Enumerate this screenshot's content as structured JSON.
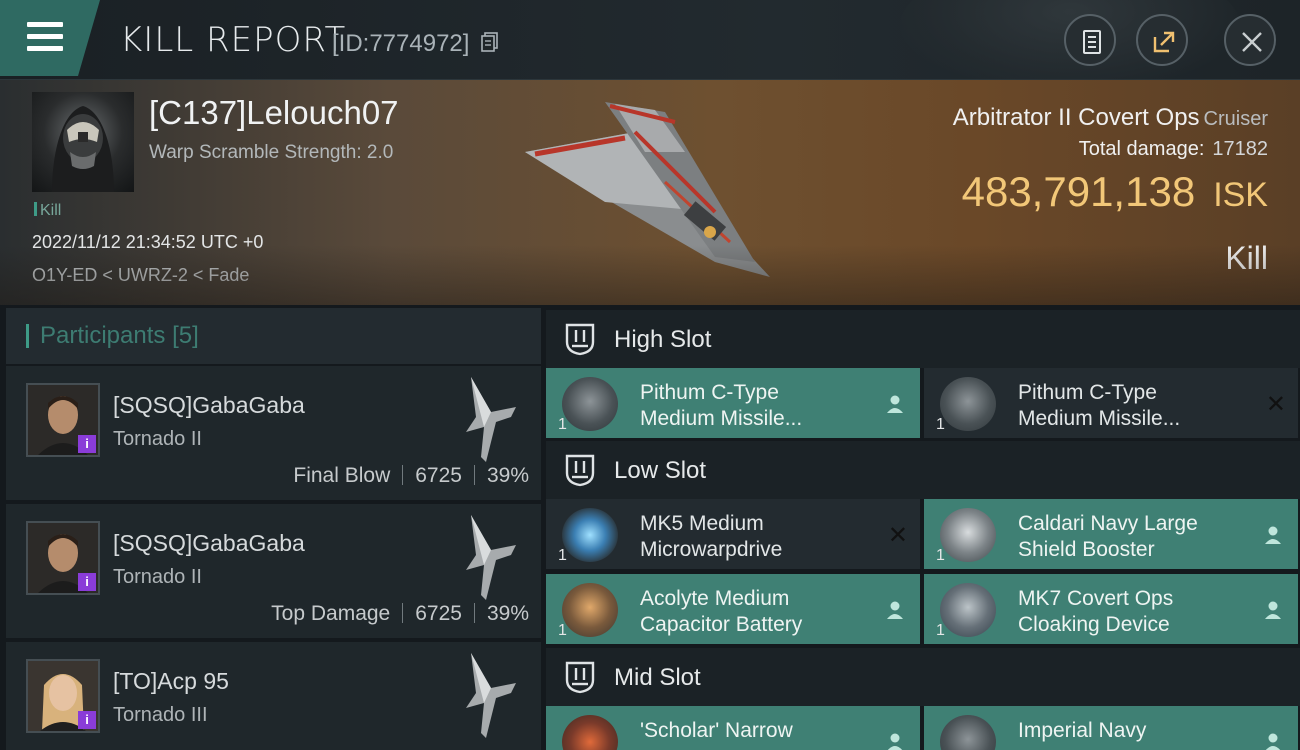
{
  "header": {
    "title": "KILL REPORT",
    "report_id": "[ID:7774972]"
  },
  "victim": {
    "name": "[C137]Lelouch07",
    "scramble": "Warp Scramble Strength: 2.0",
    "kill_tag": "Kill",
    "datetime": "2022/11/12 21:34:52 UTC +0",
    "location": "O1Y-ED < UWRZ-2 < Fade"
  },
  "ship": {
    "name": "Arbitrator II Covert Ops",
    "class": "Cruiser",
    "damage_label": "Total damage:",
    "damage_value": "17182",
    "isk_value": "483,791,138",
    "isk_unit": "ISK",
    "result": "Kill"
  },
  "participants": {
    "label": "Participants",
    "count": "[5]",
    "items": [
      {
        "name": "[SQSQ]GabaGaba",
        "ship": "Tornado II",
        "role": "Final Blow",
        "damage": "6725",
        "percent": "39%"
      },
      {
        "name": "[SQSQ]GabaGaba",
        "ship": "Tornado II",
        "role": "Top Damage",
        "damage": "6725",
        "percent": "39%"
      },
      {
        "name": "[TO]Acp 95",
        "ship": "Tornado III",
        "role": "",
        "damage": "",
        "percent": ""
      }
    ]
  },
  "slots": {
    "high": {
      "title": "High Slot",
      "modules": [
        {
          "name": "Pithum C-Type\nMedium Missile...",
          "qty": "1"
        },
        {
          "name": "Pithum C-Type\nMedium Missile...",
          "qty": "1"
        }
      ]
    },
    "low": {
      "title": "Low Slot",
      "modules": [
        {
          "name": "MK5 Medium\nMicrowarpdrive",
          "qty": "1"
        },
        {
          "name": "Caldari Navy Large\nShield Booster",
          "qty": "1"
        },
        {
          "name": "Acolyte Medium\nCapacitor Battery",
          "qty": "1"
        },
        {
          "name": "MK7 Covert Ops\nCloaking Device",
          "qty": "1"
        }
      ]
    },
    "mid": {
      "title": "Mid Slot",
      "modules": [
        {
          "name": "'Scholar' Narrow",
          "qty": ""
        },
        {
          "name": "Imperial Navy",
          "qty": ""
        }
      ]
    }
  },
  "colors": {
    "accent_teal": "#3f8074",
    "isk_gold": "#f2c778",
    "badge_purple": "#8a3cd8"
  }
}
